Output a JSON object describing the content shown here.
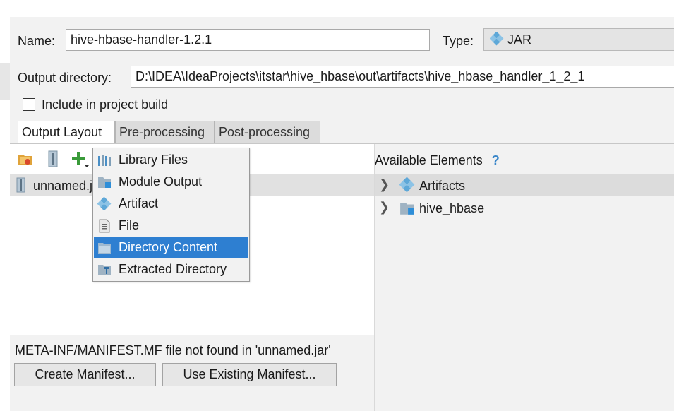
{
  "header": {
    "name_label": "Name:",
    "name_value": "hive-hbase-handler-1.2.1",
    "type_label": "Type:",
    "type_value": "JAR",
    "output_dir_label": "Output directory:",
    "output_dir_value": "D:\\IDEA\\IdeaProjects\\itstar\\hive_hbase\\out\\artifacts\\hive_hbase_handler_1_2_1",
    "include_label": "Include in project build",
    "include_checked": false
  },
  "tabs": [
    {
      "label": "Output Layout",
      "active": true
    },
    {
      "label": "Pre-processing",
      "active": false
    },
    {
      "label": "Post-processing",
      "active": false
    }
  ],
  "toolbar": {
    "icons": [
      "directory-icon",
      "archive-icon",
      "add-icon"
    ]
  },
  "left_tree": {
    "items": [
      {
        "label": "unnamed.jar",
        "icon": "archive-icon"
      }
    ]
  },
  "popup_menu": {
    "items": [
      {
        "label": "Library Files",
        "icon": "library-icon",
        "selected": false
      },
      {
        "label": "Module Output",
        "icon": "module-output-icon",
        "selected": false
      },
      {
        "label": "Artifact",
        "icon": "artifact-icon",
        "selected": false
      },
      {
        "label": "File",
        "icon": "file-icon",
        "selected": false
      },
      {
        "label": "Directory Content",
        "icon": "directory-icon",
        "selected": true
      },
      {
        "label": "Extracted Directory",
        "icon": "extracted-directory-icon",
        "selected": false
      }
    ]
  },
  "available": {
    "title": "Available Elements",
    "help": "?",
    "items": [
      {
        "label": "Artifacts",
        "icon": "artifact-icon"
      },
      {
        "label": "hive_hbase",
        "icon": "module-folder-icon"
      }
    ]
  },
  "manifest": {
    "message": "META-INF/MANIFEST.MF file not found in 'unnamed.jar'",
    "create_label": "Create Manifest...",
    "use_existing_label": "Use Existing Manifest..."
  },
  "colors": {
    "selection": "#2e7fd1",
    "panel": "#f2f2f2",
    "artifact_blue": "#5ea8d8",
    "add_green": "#3a9b3a",
    "help_blue": "#3b87c9"
  }
}
